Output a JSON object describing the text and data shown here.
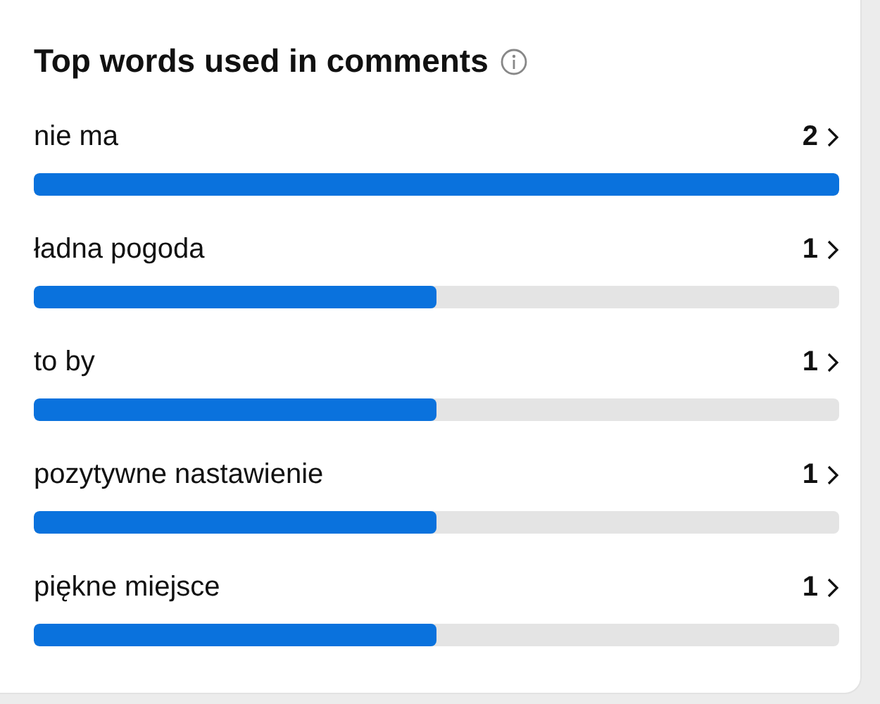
{
  "title": "Top words used in comments",
  "words": [
    {
      "label": "nie ma",
      "count": "2",
      "level": 1
    },
    {
      "label": "ładna pogoda",
      "count": "1",
      "level": 0.5
    },
    {
      "label": "to by",
      "count": "1",
      "level": 0.5
    },
    {
      "label": "pozytywne nastawienie",
      "count": "1",
      "level": 0.5
    },
    {
      "label": "piękne miejsce",
      "count": "1",
      "level": 0.5
    }
  ]
}
